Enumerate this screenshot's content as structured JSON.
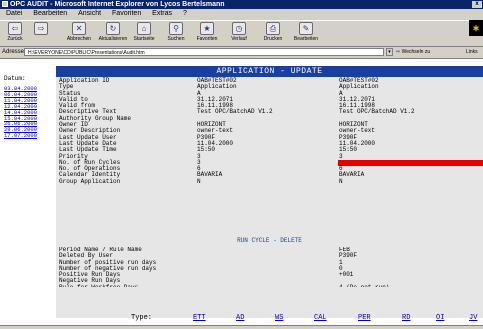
{
  "window": {
    "title": "OPC AUDIT - Microsoft Internet Explorer von Lycos Bertelsmann",
    "controls": "x"
  },
  "menu": [
    "Datei",
    "Bearbeiten",
    "Ansicht",
    "Favoriten",
    "Extras",
    "?"
  ],
  "toolbar": {
    "back": "Zurück",
    "forward": "",
    "stop": "Abbrechen",
    "refresh": "Aktualisieren",
    "home": "Startseite",
    "search": "Suchen",
    "favorites": "Favoriten",
    "history": "Verlauf",
    "print": "Drucken",
    "edit": "Bearbeiten",
    "logo": "∗"
  },
  "address": {
    "label": "Adresse",
    "value": "H:\\EVERYONE\\CD\\PUBLIC\\Presentations\\Audit.htm",
    "go": "Wechseln zu",
    "links": "Links"
  },
  "sidebar": {
    "label": "Datum:",
    "dates": [
      "03.04.2000",
      "06.04.2000",
      "11.04.2000",
      "12.04.2000",
      "14.04.2000",
      "15.04.2000",
      "26.06.2000",
      "29.06.2000",
      "17.07.2000"
    ]
  },
  "main": {
    "header": "APPLICATION - UPDATE",
    "rows": [
      {
        "label": "Application ID",
        "old": "OAB#TEST#02",
        "new": "OAB#TEST#02"
      },
      {
        "label": "Type",
        "old": "Application",
        "new": "Application"
      },
      {
        "label": "Status",
        "old": "A",
        "new": "A"
      },
      {
        "label": "Valid to",
        "old": "31.12.2071",
        "new": "31.12.2071"
      },
      {
        "label": "Valid from",
        "old": "16.11.1998",
        "new": "16.11.1998"
      },
      {
        "label": "Descriptive Text",
        "old": "Test OPC/BatchAD V1.2",
        "new": "Test OPC/BatchAD V1.2"
      },
      {
        "label": "Authority Group Name",
        "old": "",
        "new": ""
      },
      {
        "label": "Owner ID",
        "old": "HORIZONT",
        "new": "HORIZONT"
      },
      {
        "label": "Owner Description",
        "old": "owner-text",
        "new": "owner-text"
      },
      {
        "label": "Last Update User",
        "old": "P390F",
        "new": "P390F"
      },
      {
        "label": "Last Update Date",
        "old": "11.04.2000",
        "new": "11.04.2000"
      },
      {
        "label": "Last Update Time",
        "old": "15:50",
        "new": "15:50"
      },
      {
        "label": "Priority",
        "old": "3",
        "new": "3"
      },
      {
        "label": "No. of Run Cycles",
        "old": "3",
        "new": ""
      },
      {
        "label": "No. of Operations",
        "old": "6",
        "new": "6"
      },
      {
        "label": "Calendar Identity",
        "old": "BAVARIA",
        "new": "BAVARIA"
      },
      {
        "label": "Group Application",
        "old": "N",
        "new": "N"
      }
    ],
    "highlight_color": "#e60000",
    "section2": {
      "header": "RUN CYCLE - DELETE",
      "rows": [
        {
          "label": "Period Name / Rule Name",
          "value": "FEB"
        },
        {
          "label": "Deleted By User",
          "value": "P390F"
        },
        {
          "label": "Number of positive run days",
          "value": "1"
        },
        {
          "label": "Number of negative run days",
          "value": "0"
        },
        {
          "label": "Positive Run Days",
          "value": "+001"
        },
        {
          "label": "Negative Run Days",
          "value": ""
        },
        {
          "label": "Rule for Workfree Days",
          "value": "4 (Do not run)"
        }
      ]
    },
    "types": {
      "label": "Type:",
      "links": [
        "ETT",
        "AD",
        "WS",
        "CAL",
        "PER",
        "RD",
        "OI",
        "JV"
      ]
    }
  }
}
